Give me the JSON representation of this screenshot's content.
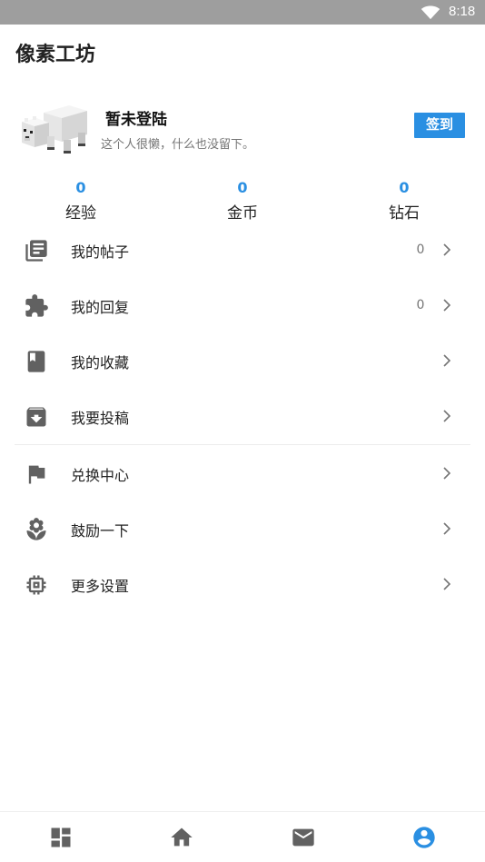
{
  "status_bar": {
    "time": "8:18",
    "wifi_icon": "wifi-icon"
  },
  "app": {
    "title": "像素工坊"
  },
  "profile": {
    "username": "暂未登陆",
    "bio": "这个人很懒，什么也没留下。",
    "signin_label": "签到",
    "avatar_icon": "pixel-polar-bear-avatar"
  },
  "stats": [
    {
      "value": "0",
      "label": "经验"
    },
    {
      "value": "0",
      "label": "金币"
    },
    {
      "value": "0",
      "label": "钻石"
    }
  ],
  "menu": [
    {
      "label": "我的帖子",
      "count": "0",
      "icon": "posts-list-icon"
    },
    {
      "label": "我的回复",
      "count": "0",
      "icon": "puzzle-icon"
    },
    {
      "label": "我的收藏",
      "count": "",
      "icon": "bookmark-book-icon"
    },
    {
      "label": "我要投稿",
      "count": "",
      "icon": "archive-icon"
    },
    {
      "label": "兑换中心",
      "count": "",
      "icon": "flag-icon"
    },
    {
      "label": "鼓励一下",
      "count": "",
      "icon": "flower-icon"
    },
    {
      "label": "更多设置",
      "count": "",
      "icon": "chip-settings-icon"
    }
  ],
  "bottom_nav": [
    {
      "name": "dashboard-icon"
    },
    {
      "name": "home-icon"
    },
    {
      "name": "mail-icon"
    },
    {
      "name": "account-icon",
      "active": true
    }
  ],
  "colors": {
    "accent": "#2a8fe2",
    "icon_gray": "#616161",
    "status_bar": "#9e9e9e"
  }
}
